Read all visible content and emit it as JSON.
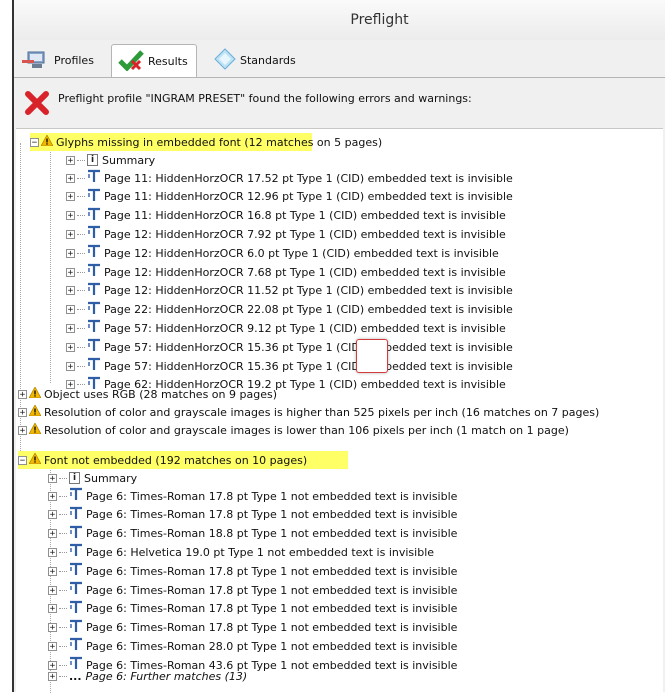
{
  "window": {
    "title": "Preflight"
  },
  "tabs": [
    {
      "label": "Profiles",
      "icon": "profiles-icon"
    },
    {
      "label": "Results",
      "icon": "check-results-icon"
    },
    {
      "label": "Standards",
      "icon": "standards-diamond-icon"
    }
  ],
  "message": {
    "text": "Preflight profile \"INGRAM PRESET\" found the following errors and warnings:",
    "icon": "red-x-icon"
  },
  "tree": {
    "glyphs_group": {
      "label": "Glyphs missing in embedded font (12 matches on 5 pages)",
      "summary": "Summary",
      "items": [
        "Page 11: HiddenHorzOCR 17.52 pt Type 1 (CID) embedded text is invisible",
        "Page 11: HiddenHorzOCR 12.96 pt Type 1 (CID) embedded text is invisible",
        "Page 11: HiddenHorzOCR 16.8 pt Type 1 (CID) embedded text is invisible",
        "Page 12: HiddenHorzOCR 7.92 pt Type 1 (CID) embedded text is invisible",
        "Page 12: HiddenHorzOCR 6.0 pt Type 1 (CID) embedded text is invisible",
        "Page 12: HiddenHorzOCR 7.68 pt Type 1 (CID) embedded text is invisible",
        "Page 12: HiddenHorzOCR 11.52 pt Type 1 (CID) embedded text is invisible",
        "Page 22: HiddenHorzOCR 22.08 pt Type 1 (CID) embedded text is invisible",
        "Page 57: HiddenHorzOCR 9.12 pt Type 1 (CID) embedded text is invisible",
        "Page 57: HiddenHorzOCR 15.36 pt Type 1 (CID) embedded text is invisible",
        "Page 57: HiddenHorzOCR 15.36 pt Type 1 (CID) embedded text is invisible",
        "Page 62: HiddenHorzOCR 19.2 pt Type 1 (CID) embedded text is invisible"
      ]
    },
    "rgb_group": {
      "label": "Object uses RGB (28 matches on 9 pages)"
    },
    "res_high_group": {
      "label": "Resolution of color and grayscale images is higher than 525 pixels per inch (16 matches on 7 pages)"
    },
    "res_low_group": {
      "label": "Resolution of color and grayscale images is lower than 106 pixels per inch (1 match on 1 page)"
    },
    "font_group": {
      "label": "Font not embedded (192 matches on 10 pages)",
      "summary": "Summary",
      "items": [
        "Page 6: Times-Roman 17.8 pt Type 1 not embedded text is invisible",
        "Page 6: Times-Roman 17.8 pt Type 1 not embedded text is invisible",
        "Page 6: Times-Roman 18.8 pt Type 1 not embedded text is invisible",
        "Page 6: Helvetica 19.0 pt Type 1 not embedded text is invisible",
        "Page 6: Times-Roman 17.8 pt Type 1 not embedded text is invisible",
        "Page 6: Times-Roman 17.8 pt Type 1 not embedded text is invisible",
        "Page 6: Times-Roman 17.8 pt Type 1 not embedded text is invisible",
        "Page 6: Times-Roman 17.8 pt Type 1 not embedded text is invisible",
        "Page 6: Times-Roman 28.0 pt Type 1 not embedded text is invisible",
        "Page 6: Times-Roman 43.6 pt Type 1 not embedded text is invisible"
      ],
      "further": "Page 6: Further matches (13)"
    }
  },
  "colors": {
    "highlight": "#ffff66",
    "warning": "#f2b800",
    "error": "#d8232a",
    "text_icon": "#2f5ea6"
  }
}
